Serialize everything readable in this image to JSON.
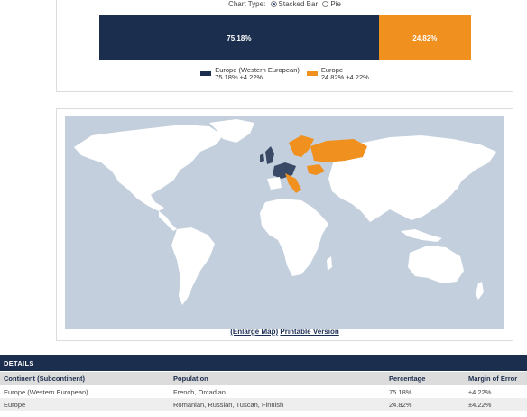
{
  "chart": {
    "type_label": "Chart Type:",
    "option_stacked": "Stacked Bar",
    "option_pie": "Pie",
    "selected": "Stacked Bar"
  },
  "chart_data": {
    "type": "bar",
    "categories": [
      "Europe (Western European)",
      "Europe"
    ],
    "values": [
      75.18,
      24.82
    ],
    "labels": [
      "75.18%",
      "24.82%"
    ],
    "colors": [
      "#1c2e4d",
      "#f0901e"
    ],
    "legend": [
      {
        "name": "Europe (Western European)",
        "value": "75.18% ±4.22%"
      },
      {
        "name": "Europe",
        "value": "24.82% ±4.22%"
      }
    ]
  },
  "map": {
    "enlarge": "(Enlarge Map)",
    "printable": "Printable Version",
    "ocean_color": "#c3cfdc",
    "land_color": "#ffffff",
    "western_color": "#3a4a66",
    "europe_color": "#f0901e"
  },
  "details": {
    "title": "DETAILS",
    "columns": [
      "Continent (Subcontinent)",
      "Population",
      "Percentage",
      "Margin of Error"
    ],
    "rows": [
      [
        "Europe (Western European)",
        "French, Orcadian",
        "75.18%",
        "±4.22%"
      ],
      [
        "Europe",
        "Romanian, Russian, Tuscan, Finnish",
        "24.82%",
        "±4.22%"
      ]
    ]
  }
}
